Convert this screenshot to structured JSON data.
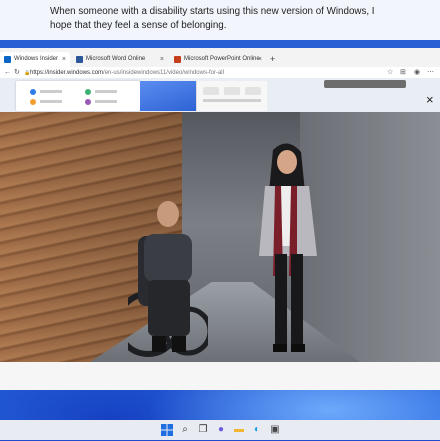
{
  "caption": {
    "text": "When someone with a disability starts using this new version of Windows, I hope that they feel a sense of belonging."
  },
  "browser": {
    "tabs": [
      {
        "label": "Windows Insider",
        "color": "#0a66c2"
      },
      {
        "label": "Microsoft Word Online",
        "color": "#2b579a"
      },
      {
        "label": "Microsoft PowerPoint Online",
        "color": "#c43e1c"
      }
    ],
    "new_tab": "+",
    "url_host": "https://insider.windows.com",
    "url_path": "/en-us/insidewindows11/video/windows-for-all"
  },
  "player": {
    "close_label": "×"
  },
  "icons": {
    "back": "back-arrow-icon",
    "refresh": "refresh-icon",
    "lock": "lock-icon",
    "favorites": "star-icon",
    "collections": "collections-icon",
    "profile": "profile-icon",
    "more": "more-icon"
  },
  "taskbar": {
    "icons": [
      "windows-start-icon",
      "search-icon",
      "task-view-icon",
      "chat-icon",
      "file-explorer-icon",
      "edge-icon",
      "store-icon"
    ]
  },
  "colors": {
    "accent": "#0a66c2",
    "wallpaper": "#1d4cc4",
    "caption_bg": "#f2f5fb"
  }
}
